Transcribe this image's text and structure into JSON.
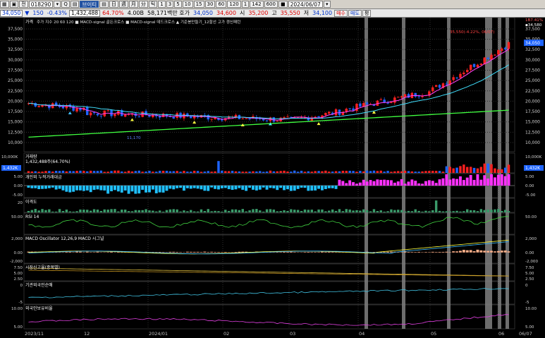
{
  "toolbar": {
    "row1": [
      "▦",
      "▣",
      "전",
      "018290",
      "▾",
      "Q",
      "▤",
      "브이티",
      "▤",
      "日",
      "週",
      "月",
      "分",
      "틱",
      "1",
      "3",
      "5",
      "10",
      "15",
      "30",
      "60",
      "120",
      "1",
      "142",
      "600",
      "■",
      "2024/06/07",
      "▾"
    ],
    "row2": {
      "price": "34,050",
      "change_arrow": "▼",
      "change": "150",
      "change_pct": "-0.43%",
      "volume": "1,432,488",
      "vol_ratio": "64.70%",
      "amount": "4.00B",
      "prev_label": "58,171백만 호가",
      "ask": "34,050",
      "bid": "34,600",
      "open_label": "시",
      "open": "35,200",
      "high_label": "고",
      "high": "35,550",
      "low_label": "저",
      "low": "34,100",
      "btn1": "매수",
      "btn2": "매도",
      "btn3": "평"
    }
  },
  "colors": {
    "up": "#ff2020",
    "down": "#1e64ff",
    "ma5": "#ff40ff",
    "ma20": "#40e0ff",
    "ma60": "#40ff40",
    "highlight": "#808080",
    "grid": "#303030"
  },
  "price_panel": {
    "legend_tag": "가격",
    "legend": "주가 지수  20  60  120 ■ MACD-signal 골든크로스 ■ MACD-signal 데드크로스 ▲ 기준봉만들기_12할선 고가 갱신패턴",
    "top_right": [
      "1B7.41%",
      "▪34,580"
    ],
    "right_ticks": [
      "37,500",
      "35,000",
      "32,500",
      "30,000",
      "27,500",
      "25,000",
      "22,500",
      "20,000",
      "17,500",
      "15,000",
      "12,500",
      "10,000"
    ],
    "left_ticks": [
      "37,500",
      "35,000",
      "32,500",
      "30,000",
      "27,500",
      "25,000",
      "22,500",
      "20,000",
      "17,500",
      "15,000",
      "12,500",
      "10,000"
    ],
    "cur_price_tag": "34,050",
    "peak_label": "35,550(-4.22%, 06/07)",
    "low_label": "11,170",
    "y_range": [
      8800,
      39200
    ]
  },
  "volume_panel": {
    "title": "거래량",
    "value": "1,432,488주(64.70%)",
    "right_ticks": [
      "10,000K",
      "5,000K"
    ],
    "tag": "1,432K"
  },
  "flow_panel": {
    "title": "개인외 누적거래대금",
    "ticks": [
      "5.00",
      "0.00",
      "-5.00"
    ]
  },
  "rsi_panel": {
    "title": "이격도",
    "ticks": [
      "20"
    ]
  },
  "stoch_panel": {
    "title": "RSI 14",
    "ticks": [
      "50.00"
    ]
  },
  "macd_panel": {
    "title": "MACD Oscillator 12,26,9  MACD  시그널",
    "ticks": [
      "2,000",
      "0.00",
      "-2,000"
    ]
  },
  "sub1_panel": {
    "title": "시장신고율(종목별)",
    "ticks": [
      "7.50",
      "5.00",
      "2.50"
    ]
  },
  "sub2_panel": {
    "title": "기관외국인순매",
    "ticks": [
      "0",
      "-5"
    ]
  },
  "sub3_panel": {
    "title": "외국인보유비율",
    "ticks": [
      "10.00",
      "5.00"
    ]
  },
  "x_axis": [
    "2023/11",
    "12",
    "2024/01",
    "02",
    "03",
    "04",
    "05",
    "06",
    "06/07"
  ]
}
